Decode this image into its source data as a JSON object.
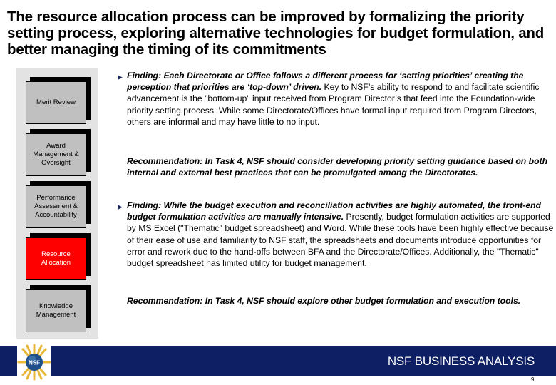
{
  "title": "The resource allocation process can be improved by formalizing the priority setting process, exploring alternative technologies for budget formulation, and better managing the timing of its commitments",
  "process_boxes": [
    {
      "label": "Merit Review",
      "active": false
    },
    {
      "label": "Award Management & Oversight",
      "active": false
    },
    {
      "label": "Performance Assessment & Accountability",
      "active": false
    },
    {
      "label": "Resource Allocation",
      "active": true
    },
    {
      "label": "Knowledge Management",
      "active": false
    }
  ],
  "colors": {
    "active_box": "#ff0000",
    "inactive_box": "#c0c0c0",
    "panel": "#e3e3e3",
    "banner": "#0e1f63"
  },
  "findings": [
    {
      "bullet_icon": "triangle-right-icon",
      "finding_bold": "Finding: Each Directorate or Office follows a different process for ‘setting priorities’ creating the perception that priorities are ‘top-down’ driven.",
      "finding_body": " Key to NSF’s ability to respond to and facilitate scientific advancement is the \"bottom-up\" input received from Program Director’s that feed into the Foundation-wide priority setting process.  While some Directorate/Offices have formal input required from Program Directors, others are informal and may have little to no input.",
      "recommendation": "Recommendation: In Task 4, NSF should consider developing priority setting guidance based on both internal and external best practices that can be promulgated among the Directorates."
    },
    {
      "bullet_icon": "triangle-right-icon",
      "finding_bold": "Finding: While the budget execution and reconciliation activities are highly automated, the front-end budget formulation activities are manually intensive.",
      "finding_body": " Presently, budget formulation activities are supported by MS Excel (\"Thematic\" budget spreadsheet) and Word.  While these tools have been highly effective because of their ease of use and familiarity to NSF staff, the spreadsheets and documents introduce opportunities for error and rework due to the hand-offs between BFA and the Directorate/Offices. Additionally, the \"Thematic\" budget spreadsheet has limited utility for budget management.",
      "recommendation": "Recommendation: In Task 4, NSF should explore other budget formulation and execution tools."
    }
  ],
  "footer": {
    "logo_icon": "nsf-logo-icon",
    "logo_text": "NSF",
    "banner_text": "NSF BUSINESS ANALYSIS",
    "page_number": "9"
  }
}
